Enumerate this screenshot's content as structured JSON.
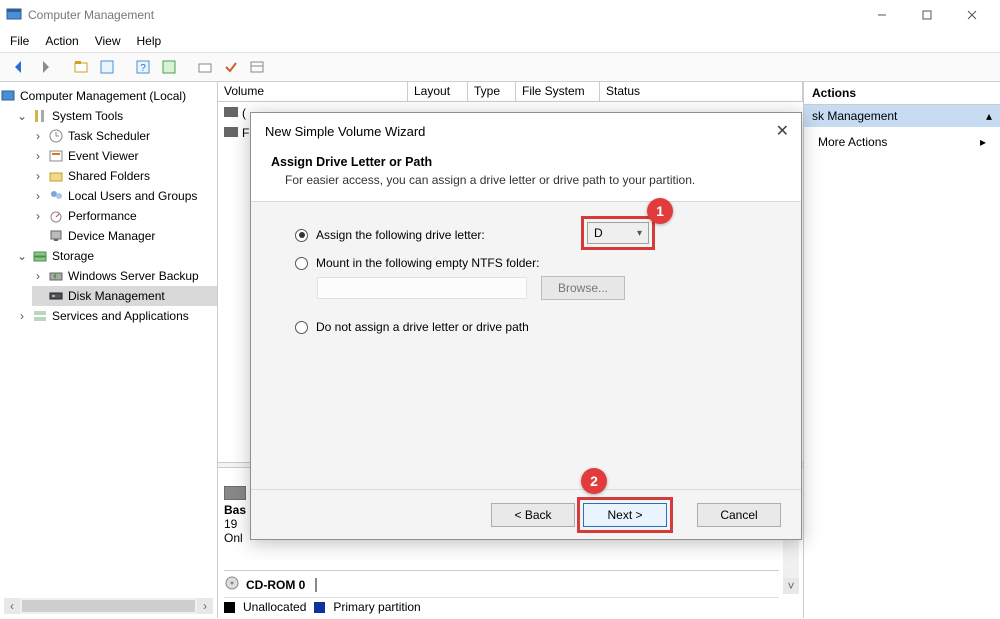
{
  "window": {
    "title": "Computer Management",
    "min": "Minimize",
    "max": "Maximize",
    "close": "Close"
  },
  "menu": {
    "file": "File",
    "action": "Action",
    "view": "View",
    "help": "Help"
  },
  "tree": {
    "root": "Computer Management (Local)",
    "system_tools": "System Tools",
    "task_scheduler": "Task Scheduler",
    "event_viewer": "Event Viewer",
    "shared_folders": "Shared Folders",
    "local_users": "Local Users and Groups",
    "performance": "Performance",
    "device_manager": "Device Manager",
    "storage": "Storage",
    "windows_backup": "Windows Server Backup",
    "disk_management": "Disk Management",
    "services_apps": "Services and Applications"
  },
  "grid": {
    "cols": {
      "volume": "Volume",
      "layout": "Layout",
      "type": "Type",
      "fs": "File System",
      "status": "Status"
    },
    "row_c": "(",
    "row_f": "F"
  },
  "lower": {
    "basic": "Bas",
    "size": "19",
    "online": "Onl",
    "cdrom": "CD-ROM 0",
    "legend_unalloc": "Unallocated",
    "legend_primary": "Primary partition"
  },
  "actions": {
    "header": "Actions",
    "group": "sk Management",
    "more": "More Actions"
  },
  "wizard": {
    "title": "New Simple Volume Wizard",
    "heading": "Assign Drive Letter or Path",
    "sub": "For easier access, you can assign a drive letter or drive path to your partition.",
    "opt1": "Assign the following drive letter:",
    "opt2": "Mount in the following empty NTFS folder:",
    "opt3": "Do not assign a drive letter or drive path",
    "letter": "D",
    "browse": "Browse...",
    "back": "< Back",
    "next": "Next >",
    "cancel": "Cancel"
  },
  "callouts": {
    "one": "1",
    "two": "2"
  }
}
